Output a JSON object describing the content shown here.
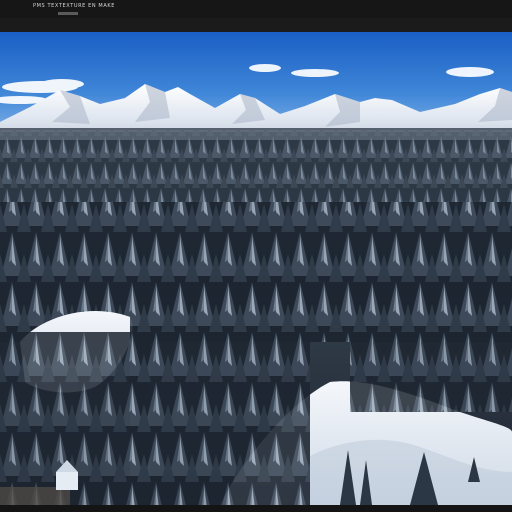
{
  "window": {
    "menu_text": "PMS TEXTEXTURE EN MAKE"
  },
  "viewport": {
    "scene": "snowy-forest-mountains",
    "colors": {
      "sky_top": "#1e64c8",
      "sky_bottom": "#7fb2e6",
      "snow": "#e9eff7",
      "forest_dark": "#1a2532",
      "forest_mid": "#3a4a5c"
    }
  }
}
